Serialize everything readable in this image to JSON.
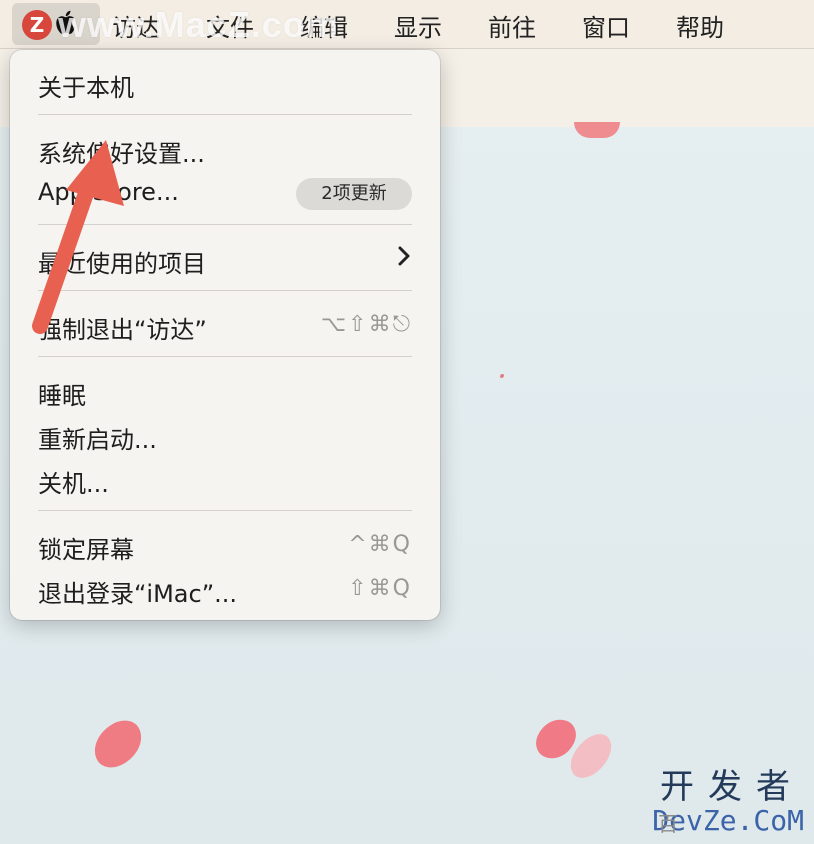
{
  "watermark_top": "www.MacZ.com",
  "menubar": {
    "z_badge": "Z",
    "items": [
      "访达",
      "文件",
      "编辑",
      "显示",
      "前往",
      "窗口",
      "帮助"
    ]
  },
  "apple_menu": {
    "about": "关于本机",
    "system_prefs": "系统偏好设置...",
    "app_store": "App Store...",
    "app_store_badge": "2项更新",
    "recent_items": "最近使用的项目",
    "force_quit": "强制退出“访达”",
    "force_quit_shortcut": "⌥⇧⌘⎋",
    "sleep": "睡眠",
    "restart": "重新启动...",
    "shutdown": "关机...",
    "lock_screen": "锁定屏幕",
    "lock_shortcut": "^⌘Q",
    "logout": "退出登录“iMac”...",
    "logout_shortcut": "⇧⌘Q"
  },
  "watermark_bottom": {
    "cn": "开发者",
    "en": "DevZe.CoM",
    "corner": "百"
  },
  "colors": {
    "accent_arrow": "#e8604f",
    "menu_bg": "#f6f4f0",
    "menubar_bg": "#f3ede4"
  }
}
